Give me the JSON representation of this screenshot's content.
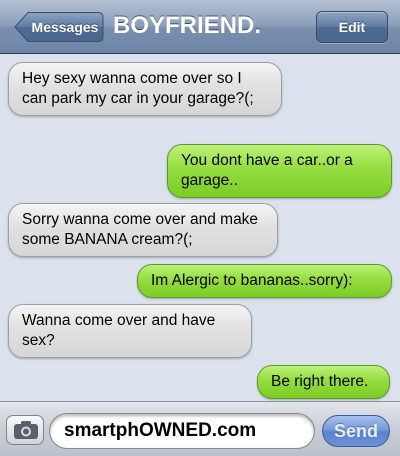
{
  "header": {
    "back_label": "Messages",
    "title": "BOYFRIEND.",
    "edit_label": "Edit"
  },
  "messages": [
    {
      "sender": "them",
      "text": "Hey sexy wanna come over so I can park my car in your garage?(;"
    },
    {
      "sender": "me",
      "text": "You dont have a car..or a garage.."
    },
    {
      "sender": "them",
      "text": "Sorry wanna come over and make some BANANA cream?(;"
    },
    {
      "sender": "me",
      "text": "Im Alergic to bananas..sorry):"
    },
    {
      "sender": "them",
      "text": "Wanna come over and have sex?"
    },
    {
      "sender": "me",
      "text": "Be right there."
    }
  ],
  "composer": {
    "camera_icon": "camera-icon",
    "field_text": "smartphOWNED.com",
    "send_label": "Send"
  },
  "colors": {
    "incoming_bubble": "#e1e1e1",
    "outgoing_bubble": "#94dd3f",
    "header_bar": "#7a90af",
    "send_button": "#6e93d6"
  }
}
